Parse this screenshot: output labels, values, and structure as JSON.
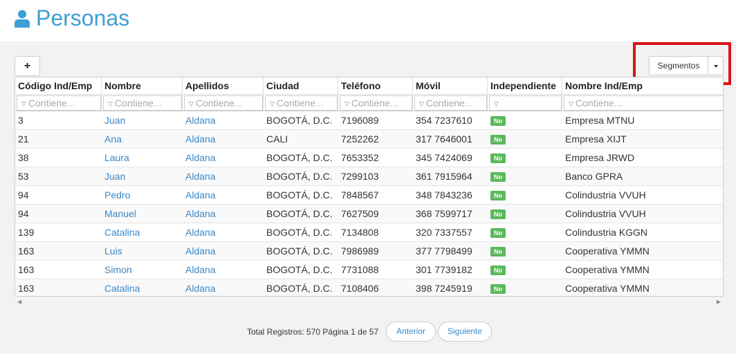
{
  "header": {
    "title": "Personas",
    "icon": "user-icon"
  },
  "toolbar": {
    "add_label": "+",
    "segmentos_label": "Segmentos"
  },
  "table": {
    "columns": [
      "Código Ind/Emp",
      "Nombre",
      "Apellidos",
      "Ciudad",
      "Teléfono",
      "Móvil",
      "Independiente",
      "Nombre Ind/Emp"
    ],
    "filter_placeholder": "Contiene...",
    "rows": [
      [
        "3",
        "Juan",
        "Aldana",
        "BOGOTÁ, D.C.",
        "7196089",
        "354 7237610",
        "No",
        "Empresa MTNU"
      ],
      [
        "21",
        "Ana",
        "Aldana",
        "CALI",
        "7252262",
        "317 7646001",
        "No",
        "Empresa XIJT"
      ],
      [
        "38",
        "Laura",
        "Aldana",
        "BOGOTÁ, D.C.",
        "7653352",
        "345 7424069",
        "No",
        "Empresa JRWD"
      ],
      [
        "53",
        "Juan",
        "Aldana",
        "BOGOTÁ, D.C.",
        "7299103",
        "361 7915964",
        "No",
        "Banco GPRA"
      ],
      [
        "94",
        "Pedro",
        "Aldana",
        "BOGOTÁ, D.C.",
        "7848567",
        "348 7843236",
        "No",
        "Colindustria VVUH"
      ],
      [
        "94",
        "Manuel",
        "Aldana",
        "BOGOTÁ, D.C.",
        "7627509",
        "368 7599717",
        "No",
        "Colindustria VVUH"
      ],
      [
        "139",
        "Catalina",
        "Aldana",
        "BOGOTÁ, D.C.",
        "7134808",
        "320 7337557",
        "No",
        "Colindustria KGGN"
      ],
      [
        "163",
        "Luis",
        "Aldana",
        "BOGOTÁ, D.C.",
        "7986989",
        "377 7798499",
        "No",
        "Cooperativa YMMN"
      ],
      [
        "163",
        "Simon",
        "Aldana",
        "BOGOTÁ, D.C.",
        "7731088",
        "301 7739182",
        "No",
        "Cooperativa YMMN"
      ],
      [
        "163",
        "Catalina",
        "Aldana",
        "BOGOTÁ, D.C.",
        "7108406",
        "398 7245919",
        "No",
        "Cooperativa YMMN"
      ]
    ]
  },
  "pager": {
    "total": "Total Registros: 570 Página 1 de 57",
    "prev_label": "Anterior",
    "next_label": "Siguiente"
  },
  "colors": {
    "accent": "#3d9fd3",
    "link": "#3a87c8",
    "badge_no": "#5cb85c",
    "highlight": "#d9131a"
  }
}
